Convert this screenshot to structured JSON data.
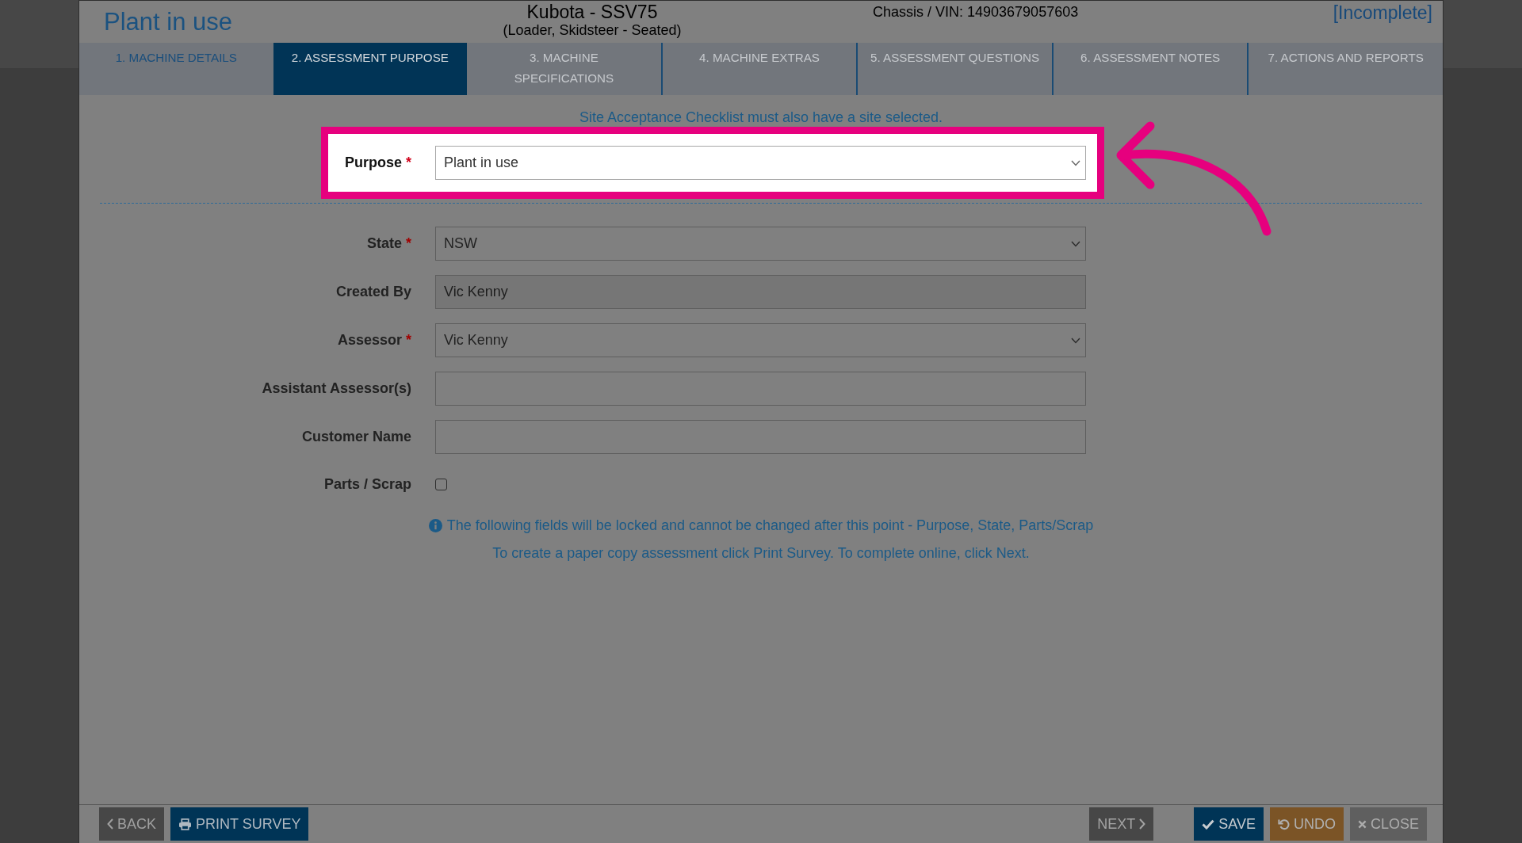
{
  "window": {
    "title": "Plant in use",
    "machine_name": "Kubota - SSV75",
    "machine_type": "(Loader, Skidsteer - Seated)",
    "chassis": "Chassis / VIN: 14903679057603",
    "status": "[Incomplete]"
  },
  "tabs": [
    {
      "label": "1. MACHINE DETAILS",
      "selected": false,
      "disabled": false
    },
    {
      "label": "2. ASSESSMENT PURPOSE",
      "selected": true,
      "disabled": false
    },
    {
      "label": "3. MACHINE\nSPECIFICATIONS",
      "selected": false,
      "disabled": true
    },
    {
      "label": "4. MACHINE EXTRAS",
      "selected": false,
      "disabled": true
    },
    {
      "label": "5. ASSESSMENT QUESTIONS",
      "selected": false,
      "disabled": true
    },
    {
      "label": "6. ASSESSMENT NOTES",
      "selected": false,
      "disabled": true
    },
    {
      "label": "7. ACTIONS AND REPORTS",
      "selected": false,
      "disabled": true
    }
  ],
  "form": {
    "notice": "Site Acceptance Checklist must also have a site selected.",
    "sections": [
      {
        "highlighted": true,
        "fields": [
          {
            "label": "Purpose",
            "required_mark": "*",
            "kind": "select",
            "value": "Plant in use"
          }
        ]
      },
      {
        "highlighted": false,
        "fields": [
          {
            "label": "State",
            "required_mark": "*",
            "kind": "select",
            "value": "NSW"
          },
          {
            "label": "Created By",
            "kind": "readonly",
            "value": "Vic Kenny"
          },
          {
            "label": "Assessor",
            "required_mark": "*",
            "kind": "select",
            "value": "Vic Kenny"
          },
          {
            "label": "Assistant Assessor(s)",
            "kind": "text"
          },
          {
            "label": "Customer Name",
            "kind": "text"
          },
          {
            "label": "Parts / Scrap",
            "kind": "checkbox",
            "checked": false
          }
        ]
      }
    ],
    "info": "The following fields will be locked and cannot be changed after this point - Purpose, State, Parts/Scrap",
    "instruction": "To create a paper copy assessment click Print Survey. To complete online, click Next."
  },
  "buttons": [
    {
      "label": "BACK",
      "kind": "back"
    },
    {
      "label": "PRINT SURVEY",
      "kind": "print"
    },
    {
      "label": "NEXT",
      "kind": "next"
    },
    {
      "label": "SAVE",
      "kind": "save"
    },
    {
      "label": "UNDO",
      "kind": "undo"
    },
    {
      "label": "CLOSE",
      "kind": "close"
    }
  ]
}
